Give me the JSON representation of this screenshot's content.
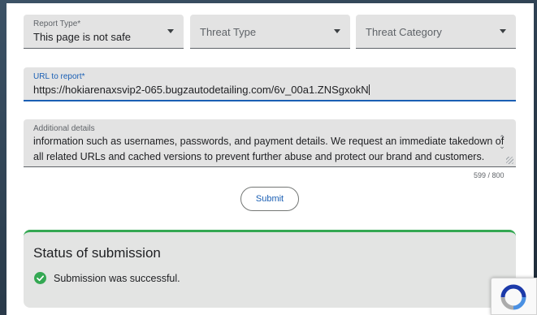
{
  "form": {
    "report_type": {
      "label": "Report Type*",
      "value": "This page is not safe"
    },
    "threat_type": {
      "placeholder": "Threat Type"
    },
    "threat_category": {
      "placeholder": "Threat Category"
    },
    "url": {
      "label": "URL to report*",
      "value": "https://hokiarenaxsvip2-065.bugzautodetailing.com/6v_00a1.ZNSgxokN"
    },
    "details": {
      "label": "Additional details",
      "value": "information such as usernames, passwords, and payment details. We request an immediate takedown of all related URLs and cached versions to prevent further abuse and protect our brand and customers.",
      "counter": "599 / 800"
    },
    "submit_label": "Submit"
  },
  "status": {
    "title": "Status of submission",
    "message": "Submission was successful.",
    "icon": "check-circle-icon",
    "color": "#34a853"
  },
  "colors": {
    "accent": "#1a5fb4",
    "field_bg": "#e3e3e3"
  },
  "recaptcha": {
    "icon": "recaptcha-logo-icon"
  }
}
